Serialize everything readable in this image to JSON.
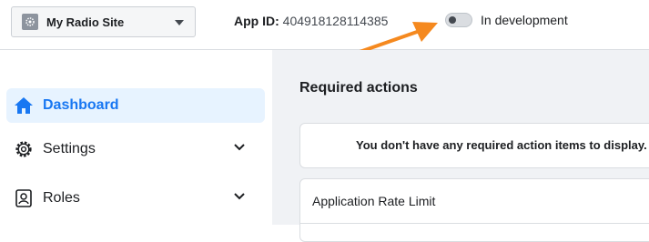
{
  "header": {
    "app_name": "My Radio Site",
    "app_id_label": "App ID:",
    "app_id_value": "404918128114385",
    "mode_toggle_state": "off",
    "mode_label": "In development"
  },
  "sidebar": {
    "items": [
      {
        "label": "Dashboard",
        "icon": "house-icon",
        "active": true
      },
      {
        "label": "Settings",
        "icon": "gear-icon",
        "expandable": true
      },
      {
        "label": "Roles",
        "icon": "id-card-icon",
        "expandable": true
      }
    ]
  },
  "main": {
    "required_actions_title": "Required actions",
    "required_actions_empty": "You don't have any required action items to display.",
    "rate_limit_title": "Application Rate Limit"
  },
  "colors": {
    "accent": "#1877f2",
    "active_bg": "#e7f3ff",
    "annotation_arrow": "#f5891f",
    "main_bg": "#f0f2f5"
  }
}
